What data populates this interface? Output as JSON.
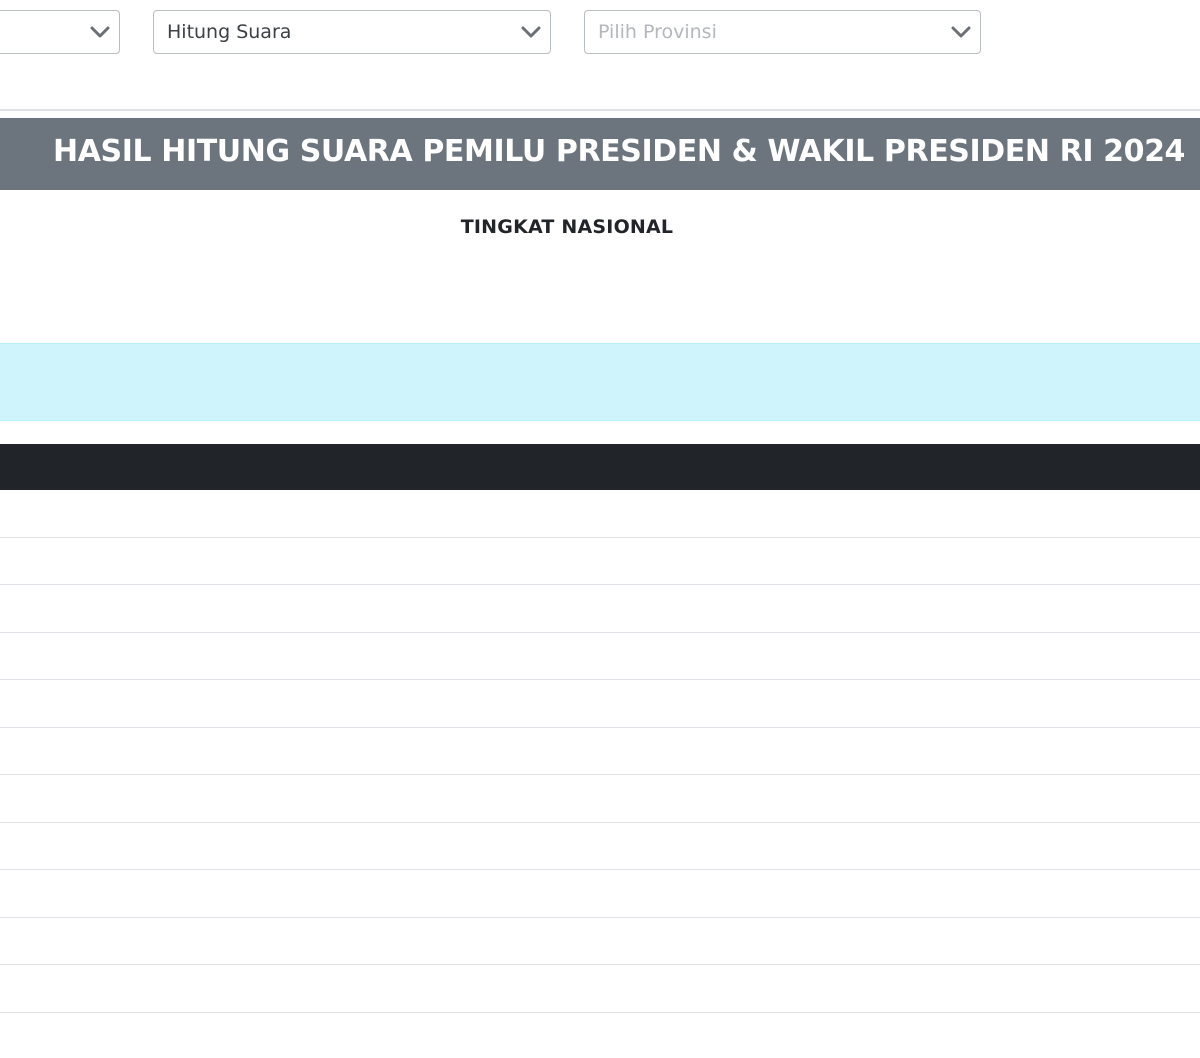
{
  "filters": {
    "election_select": {
      "value": ""
    },
    "type_select": {
      "value": "Hitung Suara"
    },
    "province_select": {
      "placeholder": "Pilih Provinsi"
    }
  },
  "header": {
    "title": "HASIL HITUNG SUARA PEMILU PRESIDEN & WAKIL PRESIDEN RI 2024",
    "subtitle": "TINGKAT NASIONAL"
  },
  "colors": {
    "title_bar": "#6c757d",
    "info_box": "#cff4fc",
    "table_header": "#212529"
  },
  "icons": {
    "dropdown": "chevron-down-icon"
  }
}
